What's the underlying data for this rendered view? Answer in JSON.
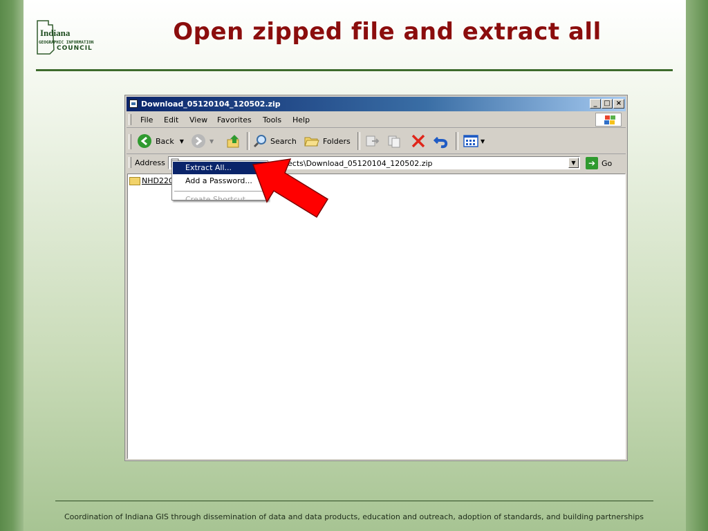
{
  "slide": {
    "title": "Open zipped file and extract all",
    "footer": "Coordination of Indiana GIS through dissemination of data and data products, education and outreach, adoption of standards, and building partnerships",
    "logo": {
      "line1": "Indiana",
      "line2": "GEOGRAPHIC INFORMATION",
      "line3": "COUNCIL"
    }
  },
  "window": {
    "title": "Download_05120104_120502.zip",
    "controls": {
      "minimize": "_",
      "maximize": "□",
      "close": "×"
    },
    "menu": [
      "File",
      "Edit",
      "View",
      "Favorites",
      "Tools",
      "Help"
    ],
    "toolbar": {
      "back": "Back",
      "search": "Search",
      "folders": "Folders"
    },
    "address": {
      "label": "Address",
      "visible_path": "ects\\Download_05120104_120502.zip",
      "go": "Go"
    },
    "files": [
      {
        "name": "NHD2205"
      }
    ]
  },
  "context_menu": {
    "items": [
      {
        "label": "Extract All...",
        "selected": true,
        "disabled": false
      },
      {
        "label": "Add a Password...",
        "selected": false,
        "disabled": false
      },
      {
        "label": "Create Shortcut",
        "selected": false,
        "disabled": true
      }
    ]
  },
  "colors": {
    "title": "#8b0d0d",
    "accent_rule": "#3d6b2c",
    "titlebar_start": "#0a246a",
    "menu_highlight": "#0a246a",
    "arrow": "#ff0000"
  }
}
